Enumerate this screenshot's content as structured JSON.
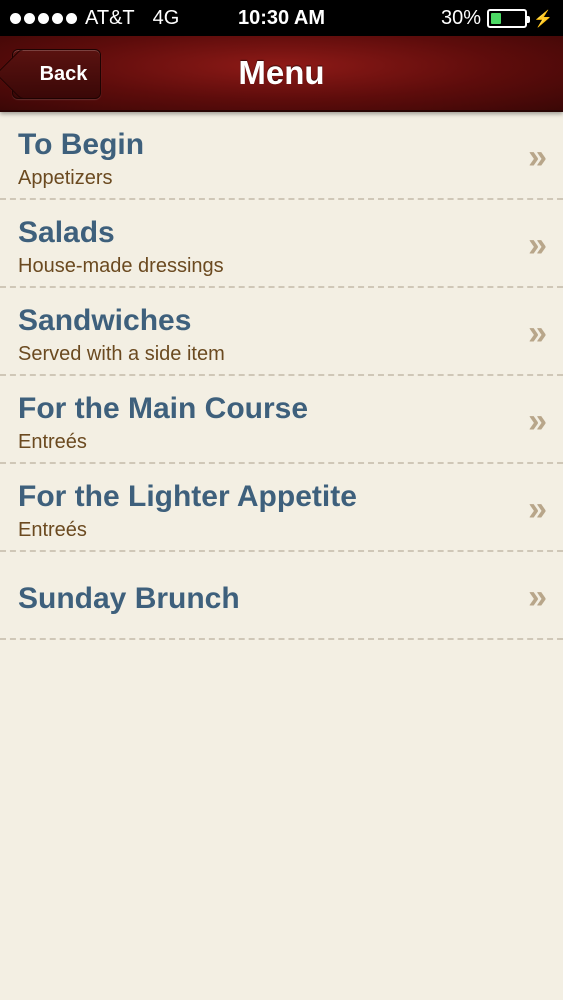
{
  "status_bar": {
    "carrier": "AT&T",
    "network": "4G",
    "time": "10:30 AM",
    "battery_percent": "30%",
    "battery_level": 0.3
  },
  "nav": {
    "back_label": "Back",
    "title": "Menu"
  },
  "menu_items": [
    {
      "title": "To Begin",
      "subtitle": "Appetizers"
    },
    {
      "title": "Salads",
      "subtitle": "House-made dressings"
    },
    {
      "title": "Sandwiches",
      "subtitle": "Served with a side item"
    },
    {
      "title": "For the Main Course",
      "subtitle": "Entreés"
    },
    {
      "title": "For the Lighter Appetite",
      "subtitle": "Entreés"
    },
    {
      "title": "Sunday Brunch",
      "subtitle": ""
    }
  ],
  "chevron_glyph": "»",
  "colors": {
    "nav_red": "#6e1211",
    "title_blue": "#3e607c",
    "subtitle_brown": "#6b4a20",
    "background": "#f3efe3",
    "battery_green": "#4cd964"
  }
}
